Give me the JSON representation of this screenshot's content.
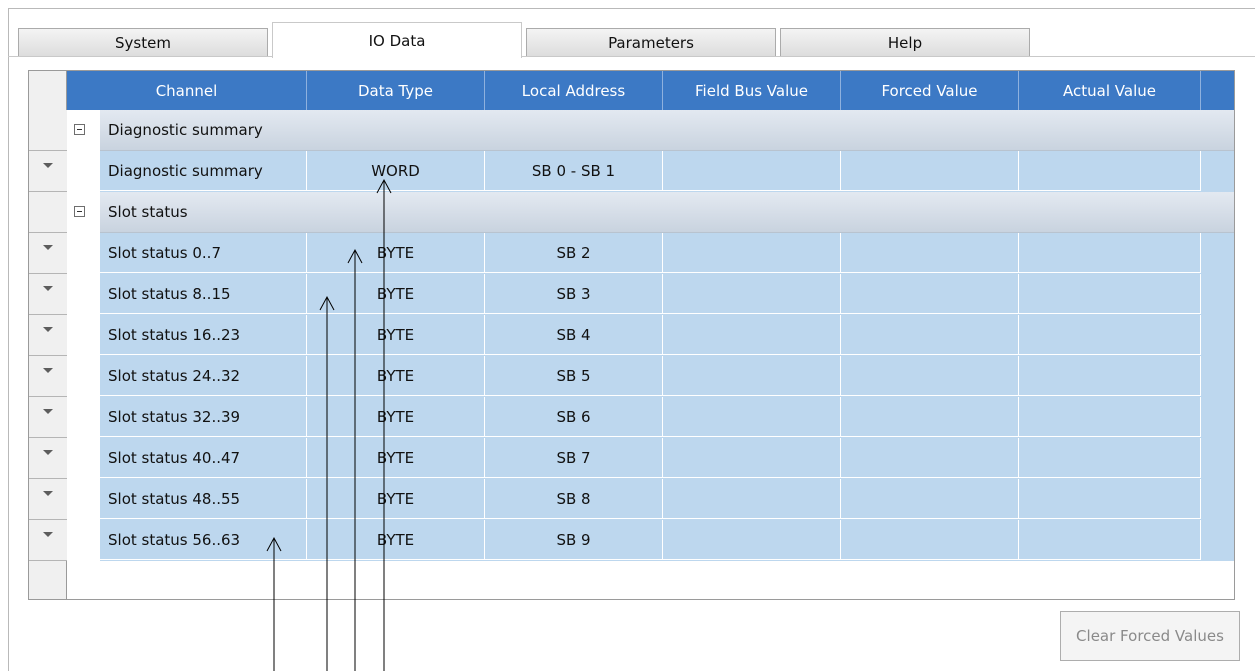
{
  "tabs": [
    "System",
    "IO Data",
    "Parameters",
    "Help"
  ],
  "columns": [
    "Channel",
    "Data Type",
    "Local Address",
    "Field Bus Value",
    "Forced Value",
    "Actual Value"
  ],
  "groups": [
    {
      "name": "Diagnostic summary",
      "rows": [
        {
          "channel": "Diagnostic summary",
          "type": "WORD",
          "address": "SB 0 - SB 1",
          "field": "",
          "forced": "",
          "actual": ""
        }
      ]
    },
    {
      "name": "Slot status",
      "rows": [
        {
          "channel": "Slot status 0..7",
          "type": "BYTE",
          "address": "SB 2",
          "field": "",
          "forced": "",
          "actual": ""
        },
        {
          "channel": "Slot status 8..15",
          "type": "BYTE",
          "address": "SB 3",
          "field": "",
          "forced": "",
          "actual": ""
        },
        {
          "channel": "Slot status 16..23",
          "type": "BYTE",
          "address": "SB 4",
          "field": "",
          "forced": "",
          "actual": ""
        },
        {
          "channel": "Slot status 24..32",
          "type": "BYTE",
          "address": "SB 5",
          "field": "",
          "forced": "",
          "actual": ""
        },
        {
          "channel": "Slot status 32..39",
          "type": "BYTE",
          "address": "SB 6",
          "field": "",
          "forced": "",
          "actual": ""
        },
        {
          "channel": "Slot status 40..47",
          "type": "BYTE",
          "address": "SB 7",
          "field": "",
          "forced": "",
          "actual": ""
        },
        {
          "channel": "Slot status 48..55",
          "type": "BYTE",
          "address": "SB 8",
          "field": "",
          "forced": "",
          "actual": ""
        },
        {
          "channel": "Slot status 56..63",
          "type": "BYTE",
          "address": "SB 9",
          "field": "",
          "forced": "",
          "actual": ""
        }
      ]
    }
  ],
  "clear_button": "Clear Forced Values",
  "colors": {
    "header": "#3c79c5",
    "row": "#bdd7ee",
    "group": "#d5dde8"
  }
}
